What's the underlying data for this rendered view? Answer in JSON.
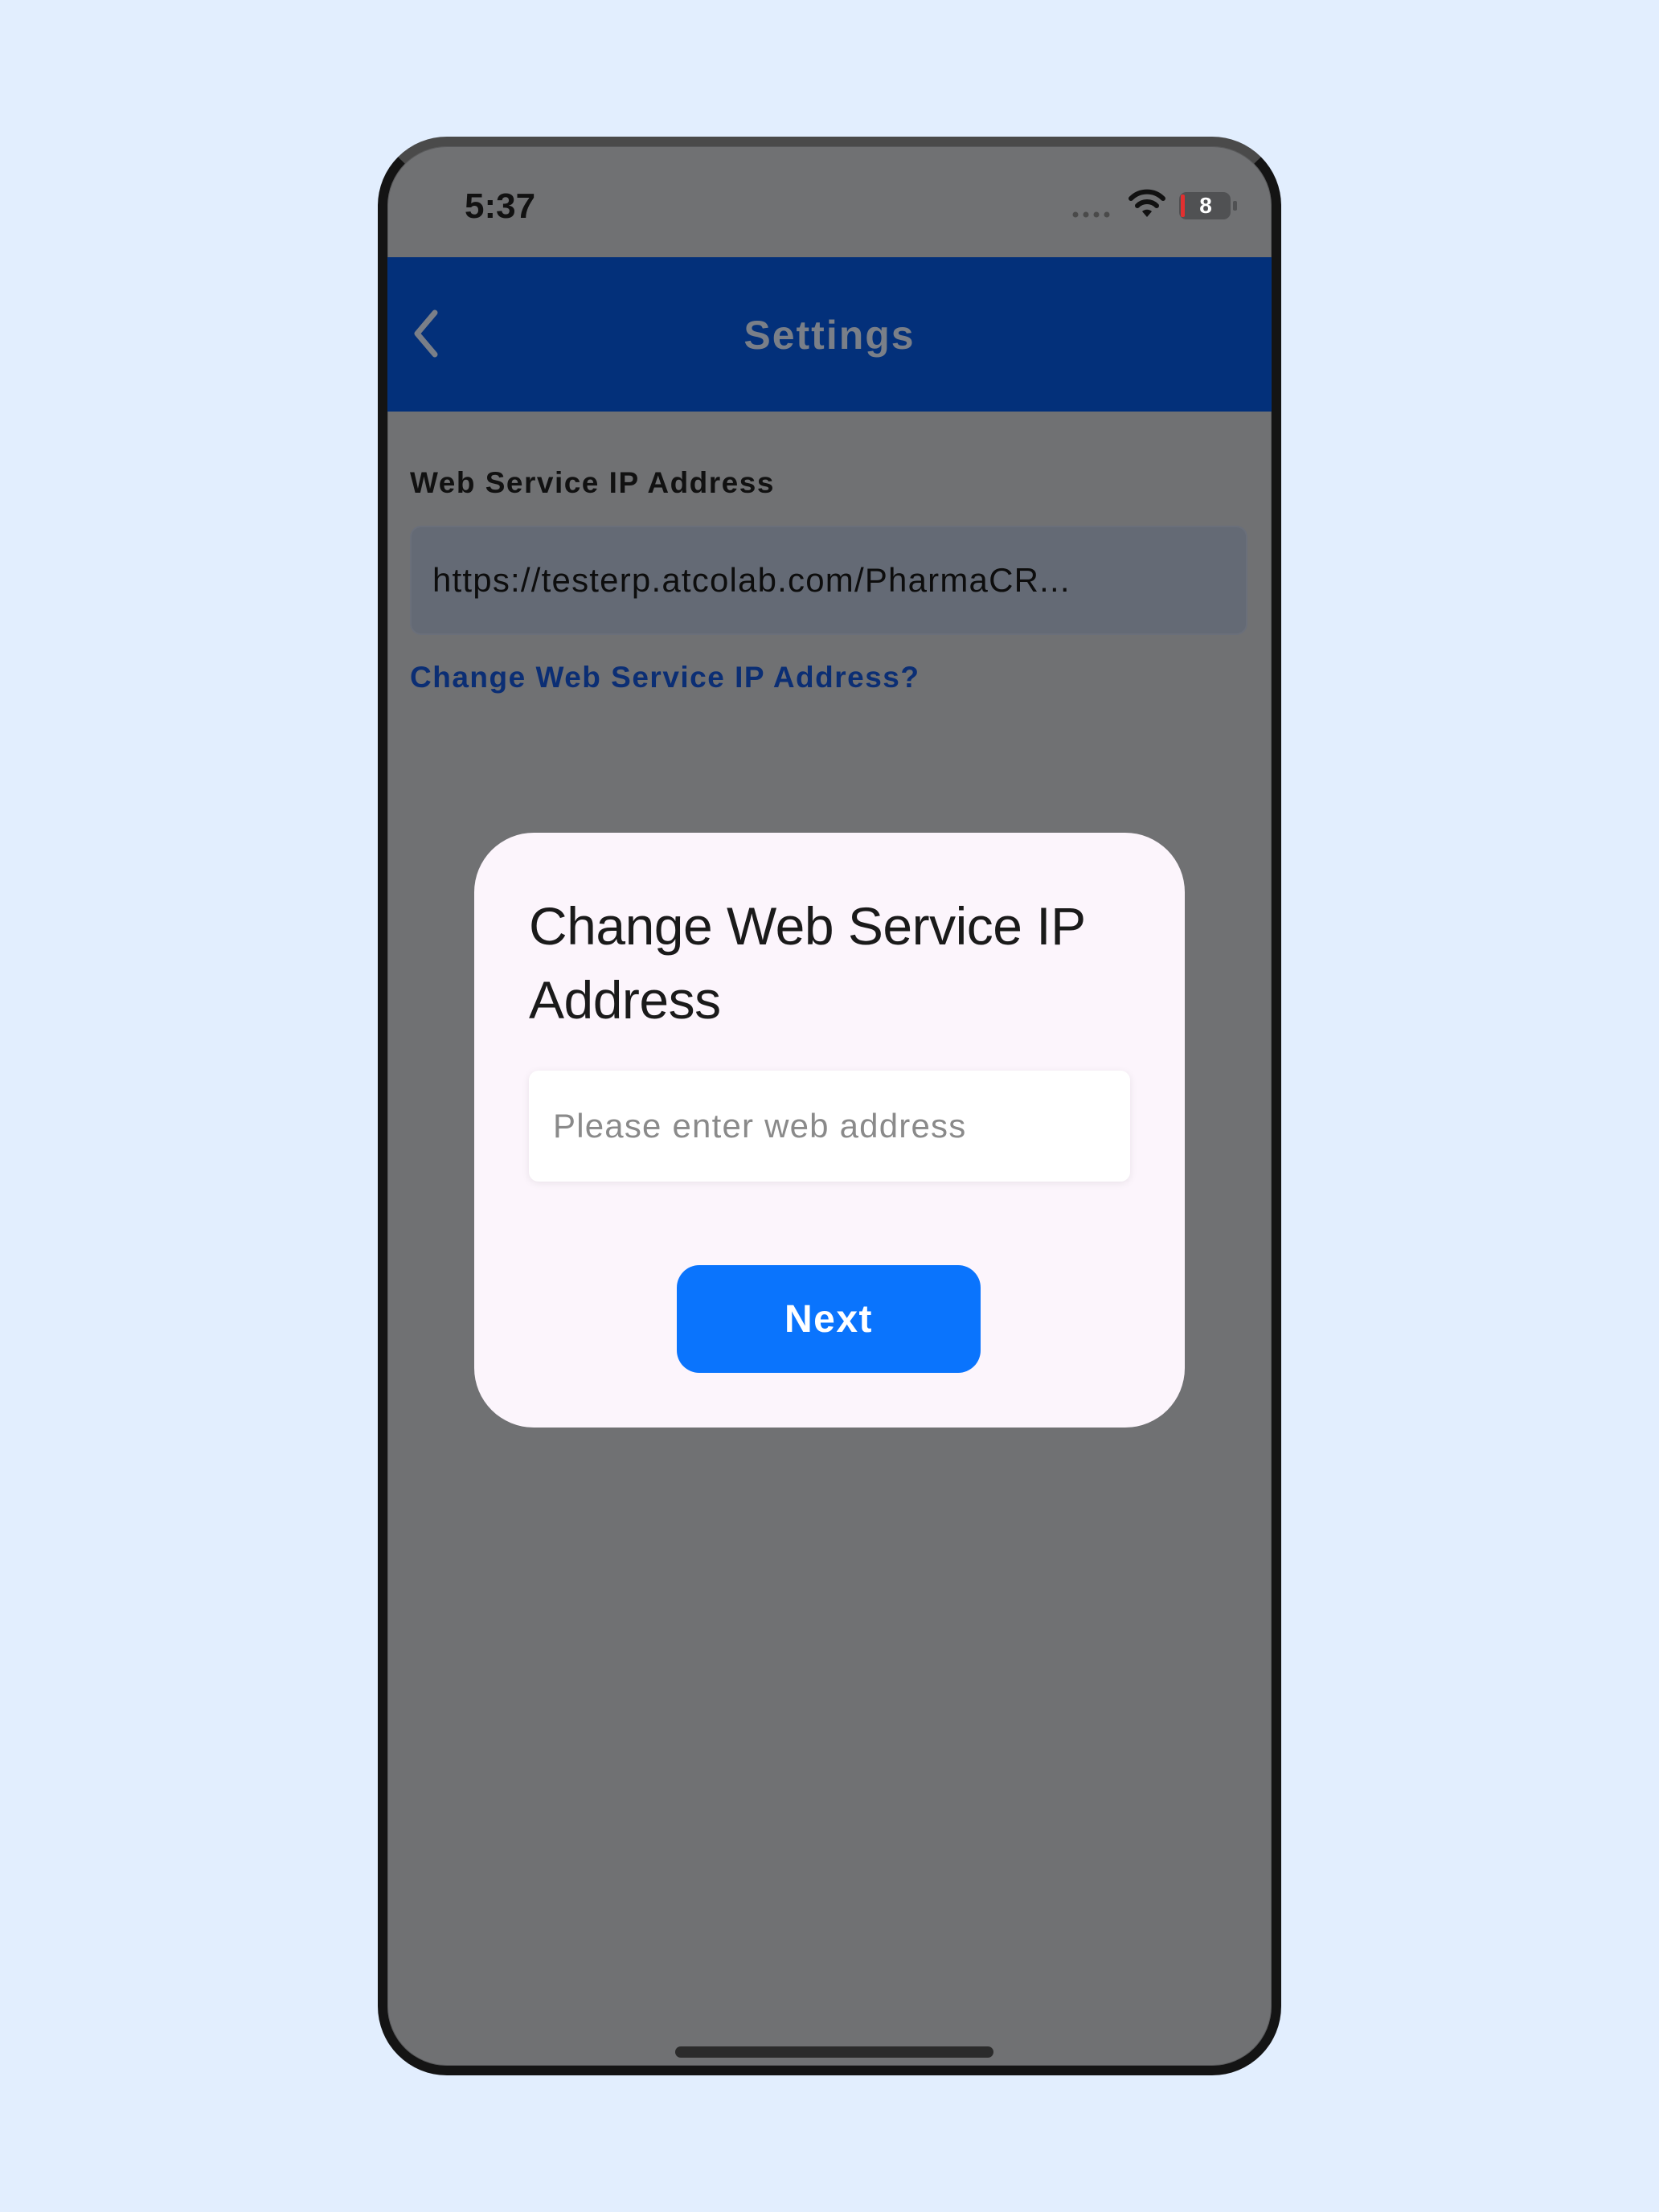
{
  "status_bar": {
    "time": "5:37",
    "battery_level": "8",
    "signal_icon": "signal-dots-icon",
    "wifi_icon": "wifi-icon",
    "battery_icon": "battery-icon"
  },
  "nav": {
    "title": "Settings",
    "back_icon": "chevron-left-icon"
  },
  "settings": {
    "ip_label": "Web Service IP Address",
    "ip_value": "https://testerp.atcolab.com/PharmaCR...",
    "change_link": "Change Web Service IP Address?"
  },
  "dialog": {
    "title": "Change Web Service IP Address",
    "input_placeholder": "Please enter web address",
    "input_value": "",
    "next_label": "Next"
  },
  "colors": {
    "page_background": "#e2eefe",
    "nav_bar": "#03307a",
    "screen_overlay": "#707173",
    "dialog_background": "#fcf5fc",
    "primary_button": "#0a74fd",
    "link": "#0b2e74"
  }
}
